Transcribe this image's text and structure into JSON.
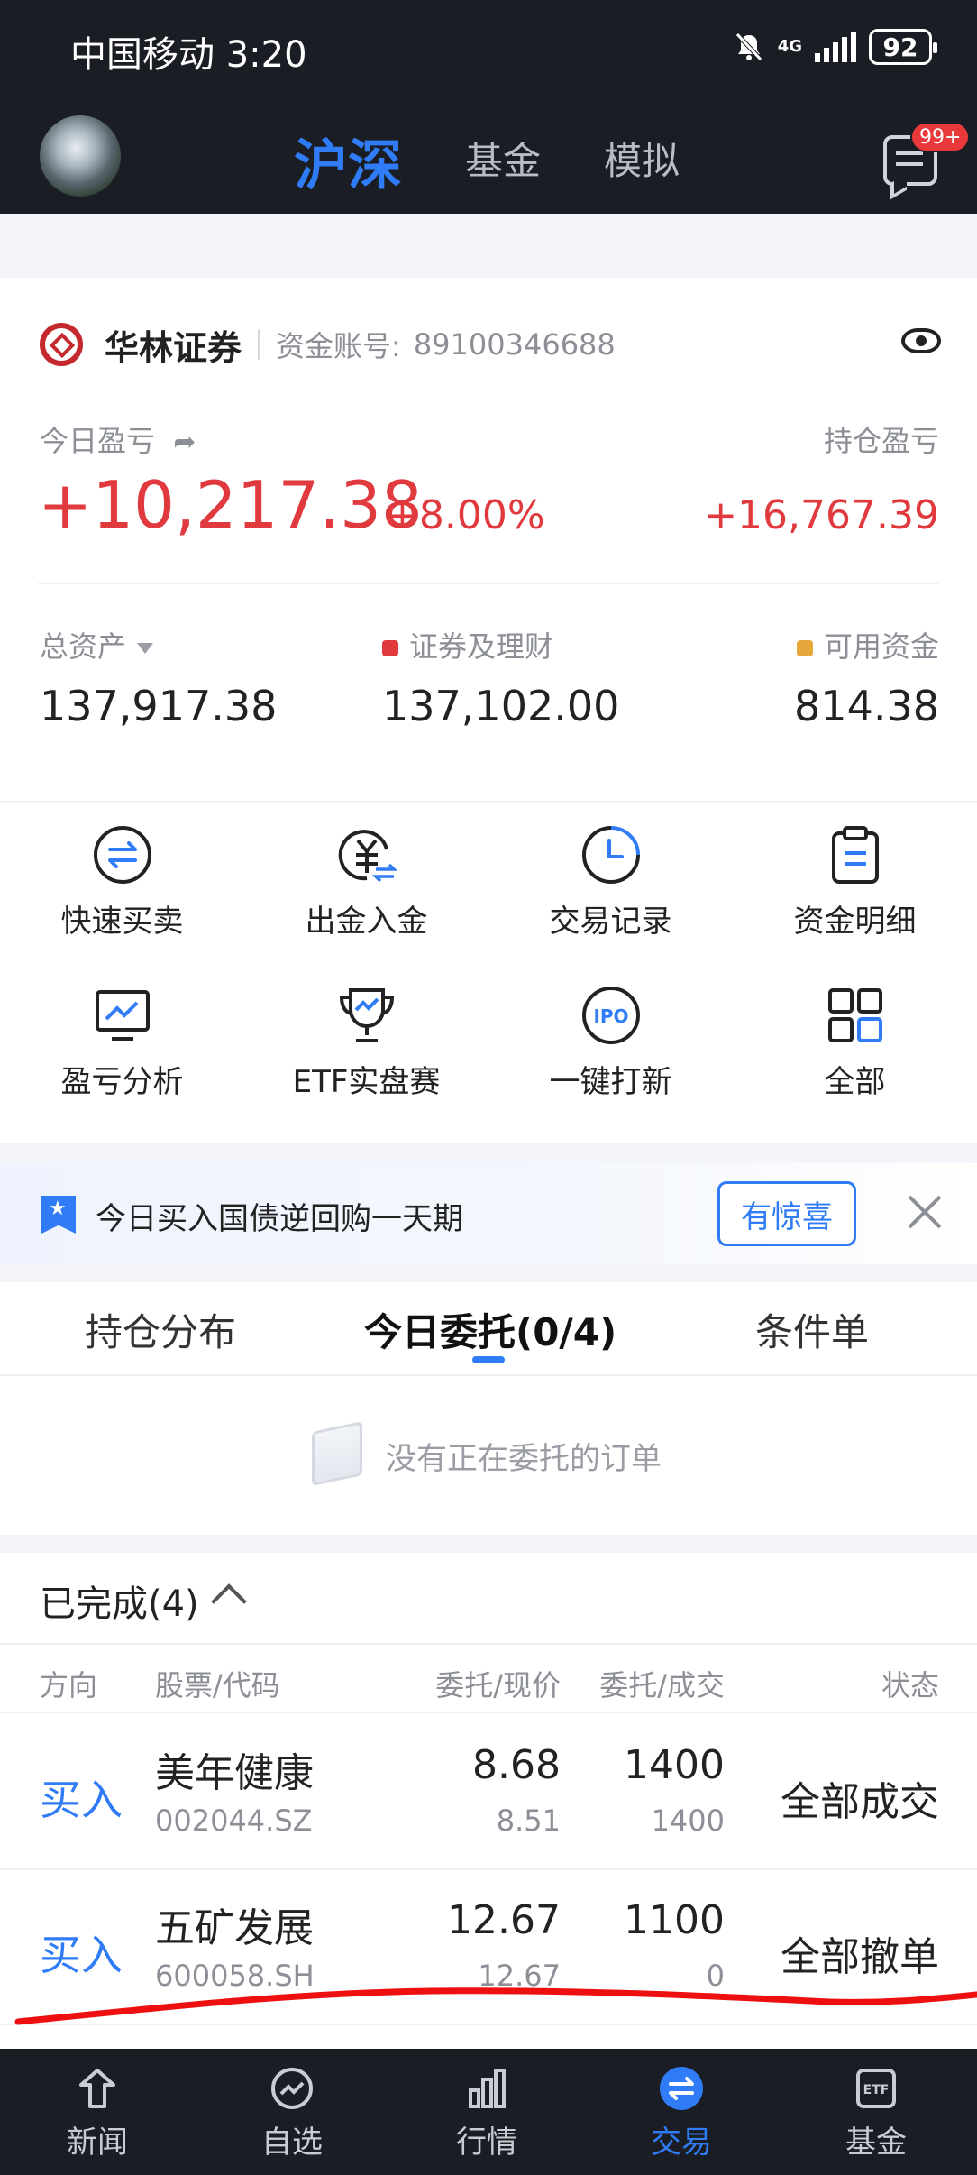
{
  "status_bar": {
    "carrier_time": "中国移动 3:20",
    "network": "4G",
    "battery": "92"
  },
  "header": {
    "tabs": [
      {
        "label": "沪深"
      },
      {
        "label": "基金"
      },
      {
        "label": "模拟"
      }
    ],
    "message_badge": "99+"
  },
  "account": {
    "broker": "华林证券",
    "account_label": "资金账号:",
    "account_no": "89100346688",
    "today_pl_label": "今日盈亏",
    "today_pl": "+10,217.38",
    "today_pl_pct": "+8.00%",
    "hold_pl_label": "持仓盈亏",
    "hold_pl": "+16,767.39",
    "total_assets_label": "总资产",
    "total_assets": "137,917.38",
    "securities_label": "证券及理财",
    "securities": "137,102.00",
    "available_label": "可用资金",
    "available": "814.38",
    "colors": {
      "red": "#e0393e",
      "orange": "#e8a73a"
    }
  },
  "shortcuts": [
    {
      "label": "快速买卖",
      "icon": "swap-icon"
    },
    {
      "label": "出金入金",
      "icon": "yuan-transfer-icon"
    },
    {
      "label": "交易记录",
      "icon": "clock-icon"
    },
    {
      "label": "资金明细",
      "icon": "clipboard-icon"
    },
    {
      "label": "盈亏分析",
      "icon": "chart-monitor-icon"
    },
    {
      "label": "ETF实盘赛",
      "icon": "trophy-icon"
    },
    {
      "label": "一键打新",
      "icon": "ipo-icon"
    },
    {
      "label": "全部",
      "icon": "grid-icon"
    }
  ],
  "promo": {
    "text": "今日买入国债逆回购一天期",
    "button": "有惊喜"
  },
  "order_tabs": [
    {
      "label": "持仓分布"
    },
    {
      "label": "今日委托(0/4)"
    },
    {
      "label": "条件单"
    }
  ],
  "empty_text": "没有正在委托的订单",
  "completed": {
    "title": "已完成(4)",
    "headers": [
      "方向",
      "股票/代码",
      "委托/现价",
      "委托/成交",
      "状态"
    ],
    "rows": [
      {
        "direction": "买入",
        "name": "美年健康",
        "code": "002044.SZ",
        "order_price": "8.68",
        "current_price": "8.51",
        "order_qty": "1400",
        "filled_qty": "1400",
        "status": "全部成交"
      },
      {
        "direction": "买入",
        "name": "五矿发展",
        "code": "600058.SH",
        "order_price": "12.67",
        "current_price": "12.67",
        "order_qty": "1100",
        "filled_qty": "0",
        "status": "全部撤单"
      }
    ]
  },
  "bottom_nav": [
    {
      "label": "新闻",
      "icon": "news-icon"
    },
    {
      "label": "自选",
      "icon": "watchlist-icon"
    },
    {
      "label": "行情",
      "icon": "market-icon"
    },
    {
      "label": "交易",
      "icon": "trade-icon"
    },
    {
      "label": "基金",
      "icon": "etf-icon"
    }
  ],
  "accent_color": "#2f7cf6"
}
